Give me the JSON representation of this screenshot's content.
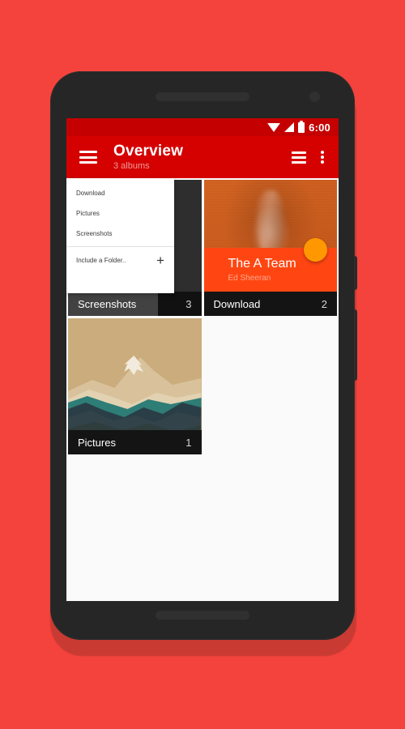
{
  "theme": {
    "background": "#F4433C",
    "phone_body": "#262626",
    "primary": "#D50000",
    "primary_dark": "#C40000",
    "accent_fab": "#FF9800",
    "now_playing_bg": "#FF4612",
    "card_bar_bg": "#141414"
  },
  "status_bar": {
    "time": "6:00",
    "icons": [
      "wifi-icon",
      "signal-icon",
      "battery-icon"
    ]
  },
  "toolbar": {
    "menu_icon": "hamburger-icon",
    "title": "Overview",
    "subtitle": "3 albums",
    "view_toggle_icon": "list-view-icon",
    "overflow_icon": "overflow-menu-icon"
  },
  "dropdown": {
    "items": [
      {
        "label": "Download"
      },
      {
        "label": "Pictures"
      },
      {
        "label": "Screenshots"
      }
    ],
    "action": {
      "label": "Include a Folder..",
      "icon": "plus-icon"
    }
  },
  "albums": [
    {
      "name": "Screenshots",
      "count": "3",
      "art": "dark"
    },
    {
      "name": "Download",
      "count": "2",
      "art": "portrait"
    },
    {
      "name": "Pictures",
      "count": "1",
      "art": "landscape"
    }
  ],
  "now_playing": {
    "title": "The A Team",
    "artist": "Ed Sheeran",
    "fab_icon": "play-fab-icon"
  },
  "nav_bar": {
    "back": "back-icon",
    "home": "home-icon",
    "recents": "recents-icon"
  }
}
